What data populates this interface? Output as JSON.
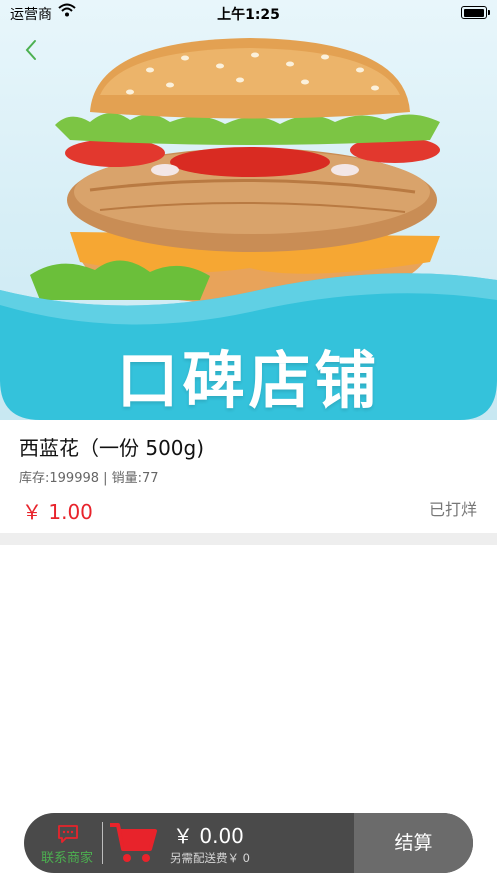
{
  "status_bar": {
    "carrier": "运营商",
    "time": "上午1:25"
  },
  "nav": {
    "back_icon": "chevron-left-icon"
  },
  "banner": {
    "text": "口碑店铺"
  },
  "product": {
    "name": "西蓝花（一份 500g)",
    "meta": "库存:199998 | 销量:77",
    "price": "￥ 1.00",
    "status": "已打烊"
  },
  "cart_bar": {
    "contact_label": "联系商家",
    "contact_icon": "chat-bubble-icon",
    "cart_icon": "shopping-cart-icon",
    "total": "￥ 0.00",
    "delivery_fee": "另需配送费￥ 0",
    "checkout_label": "结算"
  },
  "colors": {
    "accent_green": "#4cb050",
    "price_red": "#e8232b",
    "banner_teal": "#34c2db",
    "bar_dark": "#4a4a4a",
    "checkout_gray": "#6b6b6b"
  }
}
